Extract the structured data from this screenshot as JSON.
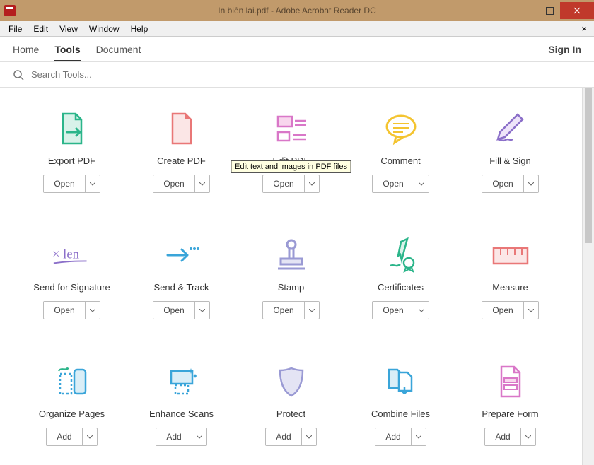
{
  "window": {
    "title": "In biên lai.pdf - Adobe Acrobat Reader DC"
  },
  "menubar": [
    "File",
    "Edit",
    "View",
    "Window",
    "Help"
  ],
  "navbar": {
    "tabs": [
      "Home",
      "Tools",
      "Document"
    ],
    "active_index": 1,
    "signin": "Sign In"
  },
  "search": {
    "placeholder": "Search Tools..."
  },
  "labels": {
    "open": "Open",
    "add": "Add"
  },
  "tooltip": "Edit text and images in PDF files",
  "tools": [
    {
      "name": "Export PDF",
      "action": "open"
    },
    {
      "name": "Create PDF",
      "action": "open"
    },
    {
      "name": "Edit PDF",
      "action": "open",
      "tooltip_shown": true
    },
    {
      "name": "Comment",
      "action": "open"
    },
    {
      "name": "Fill & Sign",
      "action": "open"
    },
    {
      "name": "Send for Signature",
      "action": "open"
    },
    {
      "name": "Send & Track",
      "action": "open"
    },
    {
      "name": "Stamp",
      "action": "open"
    },
    {
      "name": "Certificates",
      "action": "open"
    },
    {
      "name": "Measure",
      "action": "open"
    },
    {
      "name": "Organize Pages",
      "action": "add"
    },
    {
      "name": "Enhance Scans",
      "action": "add"
    },
    {
      "name": "Protect",
      "action": "add"
    },
    {
      "name": "Combine Files",
      "action": "add"
    },
    {
      "name": "Prepare Form",
      "action": "add"
    }
  ]
}
